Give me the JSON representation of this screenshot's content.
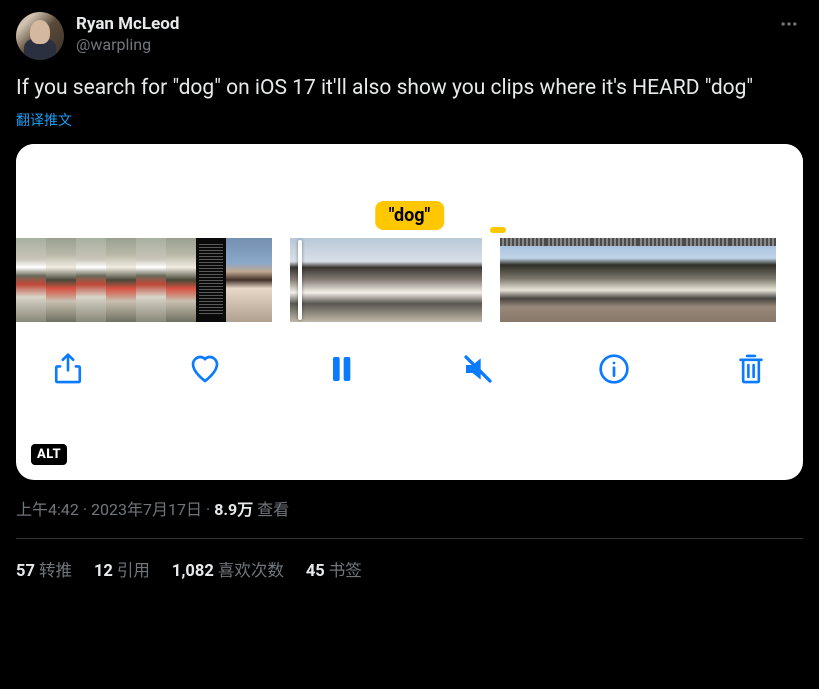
{
  "author": {
    "display_name": "Ryan McLeod",
    "handle": "@warpling"
  },
  "tweet_text": "If you search for \"dog\" on iOS 17 it'll also show you clips where it's HEARD \"dog\"",
  "translate_label": "翻译推文",
  "media": {
    "search_tag": "\"dog\"",
    "alt_badge": "ALT"
  },
  "meta": {
    "time": "上午4:42",
    "date": "2023年7月17日",
    "views_count": "8.9万",
    "views_label": "查看"
  },
  "stats": {
    "retweets_count": "57",
    "retweets_label": "转推",
    "quotes_count": "12",
    "quotes_label": "引用",
    "likes_count": "1,082",
    "likes_label": "喜欢次数",
    "bookmarks_count": "45",
    "bookmarks_label": "书签"
  }
}
